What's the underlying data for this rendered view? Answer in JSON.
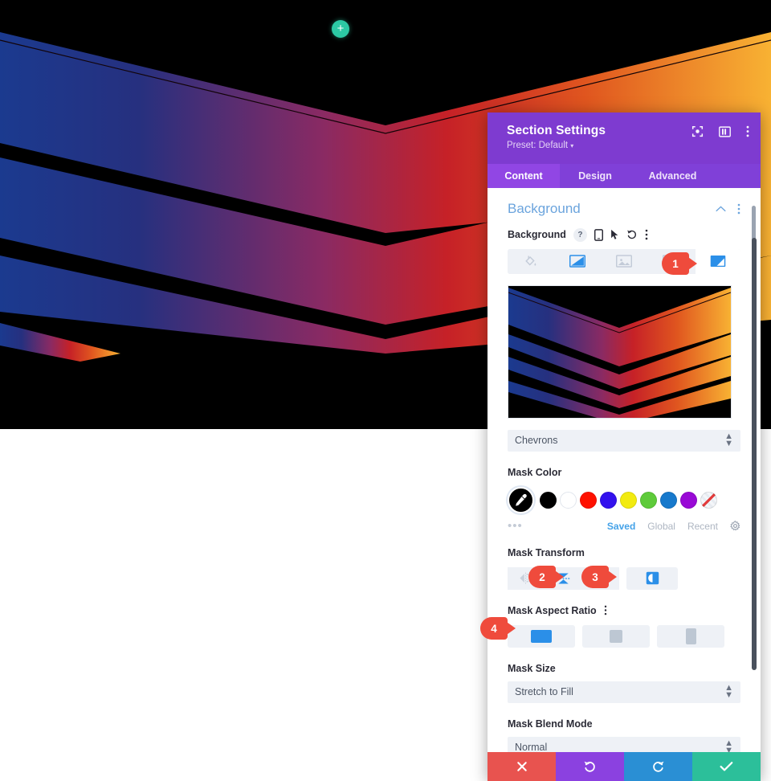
{
  "canvas": {
    "add_section_icon": "plus-icon",
    "background_colors": {
      "page": "#000000",
      "gradient_start": "#1f3a93",
      "gradient_mid": "#c2232b",
      "gradient_end": "#f5a623"
    }
  },
  "modal": {
    "title": "Section Settings",
    "preset_label": "Preset: Default",
    "preset_caret": "▾",
    "header_icons": [
      "responsive-view-icon",
      "layout-columns-icon",
      "more-options-icon"
    ],
    "tabs": [
      {
        "label": "Content",
        "active": true
      },
      {
        "label": "Design",
        "active": false
      },
      {
        "label": "Advanced",
        "active": false
      }
    ],
    "section": {
      "title": "Background",
      "collapse_icon": "chevron-up-icon",
      "options_icon": "more-options-icon"
    },
    "background_field": {
      "label": "Background",
      "help_icon": "question-mark-icon",
      "responsive_icon": "mobile-device-icon",
      "hover_icon": "cursor-pointer-icon",
      "reset_icon": "undo-reset-icon",
      "more_icon": "more-options-icon",
      "types": [
        {
          "name": "background-color-tab",
          "icon": "paint-bucket-icon",
          "active": false,
          "enabled": false
        },
        {
          "name": "background-gradient-tab",
          "icon": "gradient-icon",
          "active": false,
          "enabled": true
        },
        {
          "name": "background-image-tab",
          "icon": "image-icon",
          "active": false,
          "enabled": false
        },
        {
          "name": "background-video-tab",
          "icon": "video-icon",
          "active": false,
          "enabled": false
        },
        {
          "name": "background-mask-tab",
          "icon": "mask-icon",
          "active": true,
          "enabled": true
        }
      ]
    },
    "mask_pattern_select": {
      "value": "Chevrons",
      "arrows_glyph": "↕"
    },
    "mask_color": {
      "label": "Mask Color",
      "picker_icon": "eyedropper-icon",
      "swatches": [
        {
          "name": "swatch-black",
          "color": "#000000"
        },
        {
          "name": "swatch-white",
          "color": "#ffffff"
        },
        {
          "name": "swatch-red",
          "color": "#ff1100"
        },
        {
          "name": "swatch-blue",
          "color": "#3311ee"
        },
        {
          "name": "swatch-yellow",
          "color": "#f2eb10"
        },
        {
          "name": "swatch-green",
          "color": "#5ecb3a"
        },
        {
          "name": "swatch-cyan",
          "color": "#1779cc"
        },
        {
          "name": "swatch-purple",
          "color": "#9909d6"
        },
        {
          "name": "swatch-none",
          "color": "transparent"
        }
      ],
      "more_dots": "•••",
      "tabs": [
        {
          "label": "Saved",
          "active": true
        },
        {
          "label": "Global",
          "active": false
        },
        {
          "label": "Recent",
          "active": false
        }
      ],
      "settings_icon": "gear-icon"
    },
    "mask_transform": {
      "label": "Mask Transform",
      "buttons": [
        {
          "name": "flip-horizontal-button",
          "icon": "flip-horizontal-icon",
          "active": false
        },
        {
          "name": "flip-vertical-button",
          "icon": "flip-vertical-icon",
          "active": false
        },
        {
          "name": "rotate-button",
          "icon": "rotate-ccw-icon",
          "active": false
        },
        {
          "name": "invert-button",
          "icon": "invert-contrast-icon",
          "active": false
        }
      ]
    },
    "mask_aspect_ratio": {
      "label": "Mask Aspect Ratio",
      "options_icon": "more-options-icon",
      "options": [
        {
          "name": "aspect-landscape",
          "icon": "rect-landscape-icon",
          "active": true
        },
        {
          "name": "aspect-square",
          "icon": "rect-square-icon",
          "active": false
        },
        {
          "name": "aspect-portrait",
          "icon": "rect-portrait-icon",
          "active": false
        }
      ]
    },
    "mask_size": {
      "label": "Mask Size",
      "value": "Stretch to Fill"
    },
    "mask_blend_mode": {
      "label": "Mask Blend Mode",
      "value": "Normal"
    },
    "footer": [
      {
        "name": "cancel-button",
        "icon": "close-x-icon",
        "color": "#e8534f"
      },
      {
        "name": "undo-button",
        "icon": "undo-icon",
        "color": "#8b41e0"
      },
      {
        "name": "redo-button",
        "icon": "redo-icon",
        "color": "#2a8fd4"
      },
      {
        "name": "save-button",
        "icon": "checkmark-icon",
        "color": "#2cbf9a"
      }
    ]
  },
  "callouts": [
    {
      "number": "1",
      "target": "background-mask-tab"
    },
    {
      "number": "2",
      "target": "flip-vertical-button"
    },
    {
      "number": "3",
      "target": "rotate-button"
    },
    {
      "number": "4",
      "target": "aspect-landscape"
    }
  ]
}
